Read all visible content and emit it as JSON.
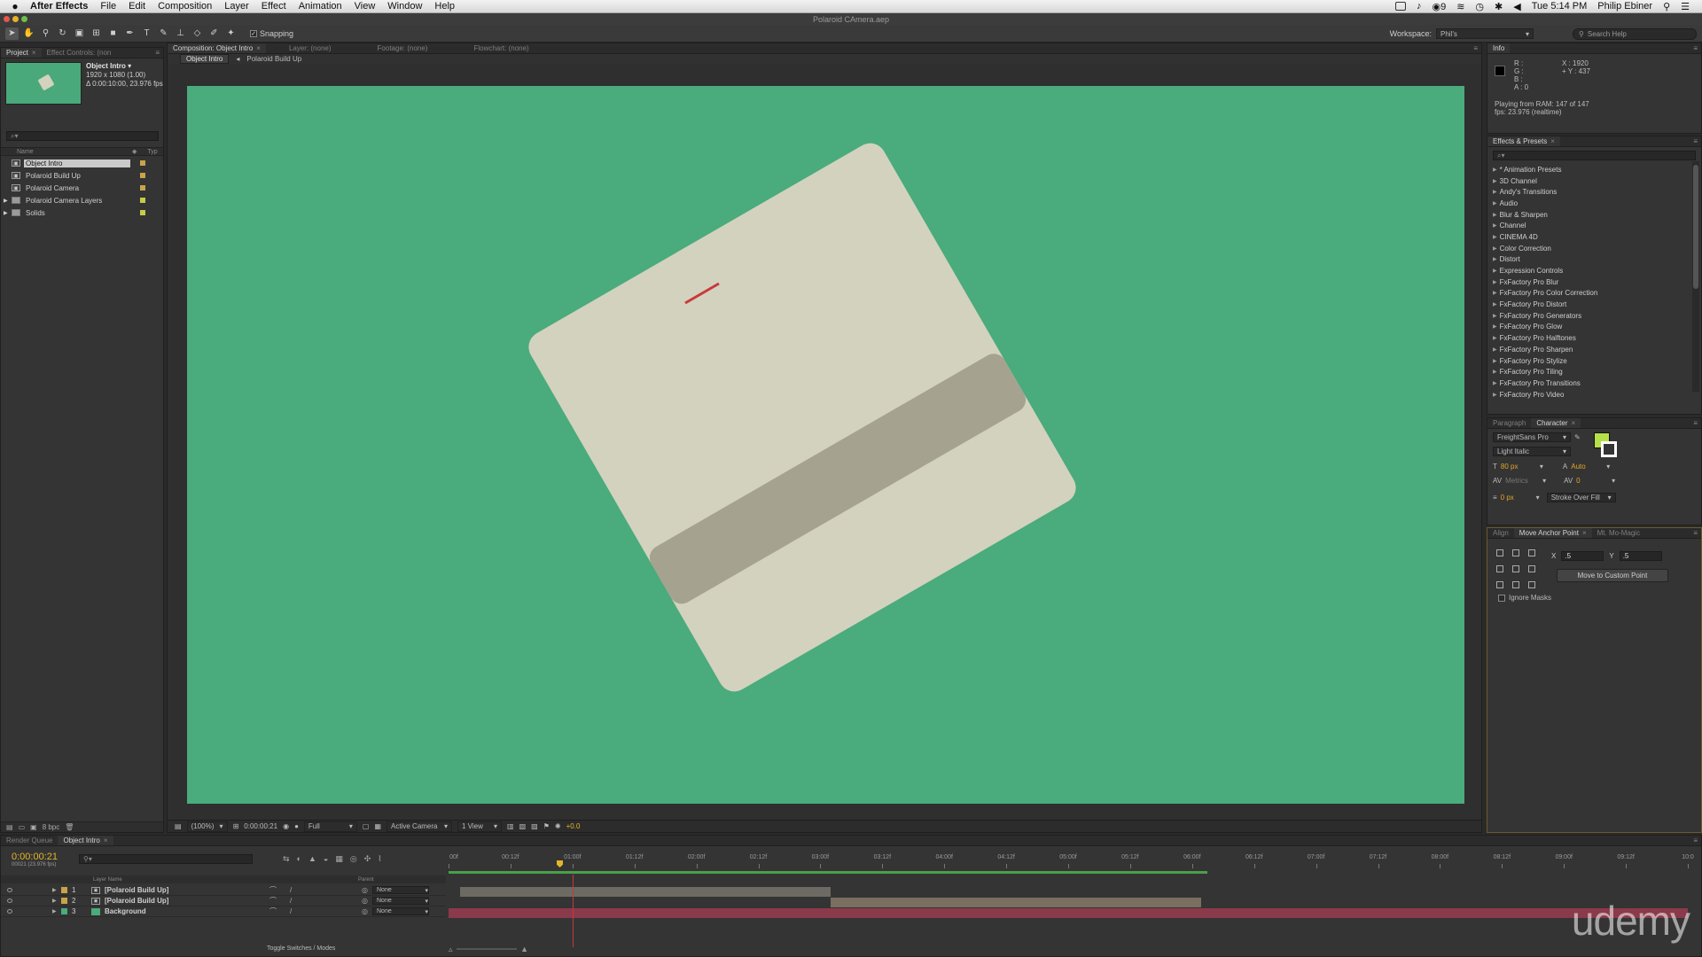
{
  "menubar": {
    "app_name": "After Effects",
    "menus": [
      "File",
      "Edit",
      "Composition",
      "Layer",
      "Effect",
      "Animation",
      "View",
      "Window",
      "Help"
    ],
    "battery": "9",
    "clock": "Tue 5:14 PM",
    "user": "Philip Ebiner"
  },
  "window": {
    "title": "Polaroid CAmera.aep"
  },
  "toolbar": {
    "snapping_label": "Snapping",
    "workspace_label": "Workspace:",
    "workspace_value": "Phil's",
    "search_placeholder": "Search Help"
  },
  "project_panel": {
    "tabs": [
      "Project",
      "Effect Controls: (non"
    ],
    "selected_name": "Object Intro ▾",
    "selected_dims": "1920 x 1080 (1.00)",
    "selected_duration": "Δ 0:00:10:00, 23.976 fps",
    "search_placeholder": "⌕▾",
    "col_name": "Name",
    "col_type": "Typ",
    "items": [
      {
        "name": "Object Intro",
        "kind": "comp",
        "color": "#c9a34a",
        "selected": true
      },
      {
        "name": "Polaroid Build Up",
        "kind": "comp",
        "color": "#c9a34a",
        "selected": false
      },
      {
        "name": "Polaroid Camera",
        "kind": "comp",
        "color": "#c9a34a",
        "selected": false
      },
      {
        "name": "Polaroid Camera Layers",
        "kind": "folder",
        "color": "#c9c94a",
        "selected": false
      },
      {
        "name": "Solids",
        "kind": "folder",
        "color": "#c9c94a",
        "selected": false
      }
    ],
    "footer_bpc": "8 bpc"
  },
  "composition_panel": {
    "tabs": [
      "Composition: Object Intro",
      "Layer: (none)",
      "Footage: (none)",
      "Flowchart: (none)"
    ],
    "subtabs": [
      "Object Intro",
      "Polaroid Build Up"
    ],
    "footer": {
      "zoom": "(100%)",
      "timecode": "0:00:00:21",
      "resolution": "Full",
      "camera": "Active Camera",
      "views": "1 View",
      "exposure": "+0.0"
    }
  },
  "info_panel": {
    "tab": "Info",
    "r": "R :",
    "g": "G :",
    "b": "B :",
    "a": "A : 0",
    "x": "X : 1920",
    "y": "+ Y : 437",
    "playing": "Playing from RAM: 147 of 147",
    "fps": "fps: 23.976 (realtime)"
  },
  "effects_panel": {
    "tab": "Effects & Presets",
    "search_placeholder": "⌕▾",
    "items": [
      "* Animation Presets",
      "3D Channel",
      "Andy's Transitions",
      "Audio",
      "Blur & Sharpen",
      "Channel",
      "CINEMA 4D",
      "Color Correction",
      "Distort",
      "Expression Controls",
      "FxFactory Pro Blur",
      "FxFactory Pro Color Correction",
      "FxFactory Pro Distort",
      "FxFactory Pro Generators",
      "FxFactory Pro Glow",
      "FxFactory Pro Halftones",
      "FxFactory Pro Sharpen",
      "FxFactory Pro Stylize",
      "FxFactory Pro Tiling",
      "FxFactory Pro Transitions",
      "FxFactory Pro Video"
    ]
  },
  "character_panel": {
    "tabs": [
      "Paragraph",
      "Character"
    ],
    "font": "FreightSans Pro",
    "style": "Light Italic",
    "size": "80 px",
    "leading": "Auto",
    "kerning": "Metrics",
    "tracking": "0",
    "stroke": "0 px",
    "stroke_mode": "Stroke Over Fill",
    "fill_color": "#b6e04a"
  },
  "anchor_panel": {
    "tabs": [
      "Align",
      "Move Anchor Point",
      "Mt. Mo-Magic"
    ],
    "x_label": "X",
    "y_label": "Y",
    "x_value": ".5",
    "y_value": ".5",
    "button": "Move to Custom Point",
    "ignore_masks": "Ignore Masks"
  },
  "timeline": {
    "tabs": [
      "Render Queue",
      "Object Intro"
    ],
    "current_time": "0:00:00:21",
    "frame_fps": "00021 (23.976 fps)",
    "col_layer_name": "Layer Name",
    "col_parent": "Parent",
    "ruler": [
      "00f",
      "00:12f",
      "01:00f",
      "01:12f",
      "02:00f",
      "02:12f",
      "03:00f",
      "03:12f",
      "04:00f",
      "04:12f",
      "05:00f",
      "05:12f",
      "06:00f",
      "06:12f",
      "07:00f",
      "07:12f",
      "08:00f",
      "08:12f",
      "09:00f",
      "09:12f",
      "10:0"
    ],
    "layers": [
      {
        "num": "1",
        "name": "[Polaroid Build Up]",
        "color": "#c9a34a",
        "parent": "None"
      },
      {
        "num": "2",
        "name": "[Polaroid Build Up]",
        "color": "#c9a34a",
        "parent": "None"
      },
      {
        "num": "3",
        "name": "Background",
        "color": "#4aab7c",
        "parent": "None"
      }
    ],
    "toggle_label": "Toggle Switches / Modes"
  },
  "watermark": "udemy"
}
